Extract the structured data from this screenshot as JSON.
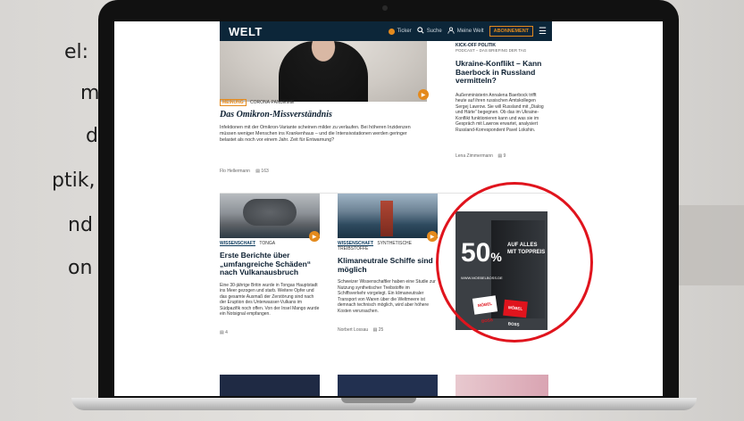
{
  "background_text": [
    "el:",
    "m",
    "d",
    "ptik,",
    "nd",
    "on"
  ],
  "header": {
    "logo": "WELT",
    "items": [
      {
        "label": "Ticker",
        "icon": "ticker-icon"
      },
      {
        "label": "Suche",
        "icon": "search-icon"
      },
      {
        "label": "Meine Welt",
        "icon": "user-icon"
      }
    ],
    "subscribe_label": "ABONNEMENT",
    "menu_icon": "menu-icon"
  },
  "lead_article": {
    "tags": [
      "MEINUNG",
      "CORONA-PANDEMIE"
    ],
    "title": "Das Omikron-Missverständnis",
    "teaser": "Infektionen mit der Omikron-Variante scheinen milder zu verlaufen. Bei höheren Inzidenzen müssen weniger Menschen ins Krankenhaus – und die Intensivstationen werden geringer belastet als noch vor einem Jahr. Zeit für Entwarnung?",
    "author": "Flo Hellermann",
    "comments": "163"
  },
  "side_article": {
    "kicker": "KICK-OFF POLITIK",
    "subkicker": "PODCAST – DAS BRIEFING DER TAG",
    "title": "Ukraine-Konflikt – Kann Baerbock in Russland vermitteln?",
    "teaser": "Außenministerin Annalena Baerbock trifft heute auf ihren russischen Amtskollegen Sergej Lawrow. Sie will Russland mit „Dialog und Härte“ begegnen. Ob das im Ukraine-Konflikt funktionieren kann und was sie im Gespräch mit Lawrow erwartet, analysiert Russland-Korrespondent Pavel Lokshin.",
    "author": "Lena Zimmermann",
    "comments": "9"
  },
  "volcano_article": {
    "tags": [
      "WISSENSCHAFT",
      "TONGA"
    ],
    "title": "Erste Berichte über „umfangreiche Schäden“ nach Vulkanausbruch",
    "teaser": "Eine 30-jährige Britin wurde in Tongas Hauptstadt ins Meer gezogen und starb. Weitere Opfer und das gesamte Ausmaß der Zerstörung sind nach der Eruption des Unterwasser-Vulkans im Südpazifik noch offen. Von der Insel Mango wurde ein Notsignal empfangen.",
    "comments": "4"
  },
  "ship_article": {
    "tags": [
      "WISSENSCHAFT",
      "SYNTHETISCHE TREIBSTOFFE"
    ],
    "title": "Klimaneutrale Schiffe sind möglich",
    "teaser": "Schweizer Wissenschaftler haben eine Studie zur Nutzung synthetischer Treibstoffe im Schiffsverkehr vorgelegt. Ein klimaneutraler Transport von Waren über die Weltmeere ist demnach technisch möglich, wird aber höhere Kosten verursachen.",
    "author": "Norbert Lossau",
    "comments": "25"
  },
  "ad": {
    "big_text": "50",
    "percent": "%",
    "brand": "MÖBEL BOSS",
    "side_text_1": "AUF ALLES",
    "side_text_2": "MIT TOPPREIS",
    "bottom_text": "WWW.MOEBELBOSS.DE"
  },
  "colors": {
    "header": "#0c2639",
    "accent": "#e48a1d",
    "highlight": "#e0141d"
  }
}
